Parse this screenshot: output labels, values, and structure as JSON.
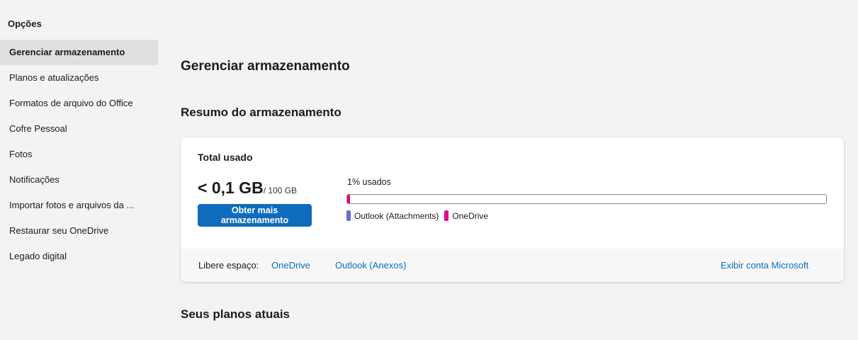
{
  "sidebar": {
    "header": "Opções",
    "items": [
      {
        "label": "Gerenciar armazenamento",
        "active": true
      },
      {
        "label": "Planos e atualizações"
      },
      {
        "label": "Formatos de arquivo do Office"
      },
      {
        "label": "Cofre Pessoal"
      },
      {
        "label": "Fotos"
      },
      {
        "label": "Notificações"
      },
      {
        "label": "Importar fotos e arquivos da ..."
      },
      {
        "label": "Restaurar seu OneDrive"
      },
      {
        "label": "Legado digital"
      }
    ]
  },
  "main": {
    "page_title": "Gerenciar armazenamento",
    "summary_title": "Resumo do armazenamento",
    "plans_title": "Seus planos atuais"
  },
  "storage": {
    "card_title": "Total usado",
    "used": "< 0,1 GB",
    "total": "/ 100 GB",
    "get_more_label": "Obter mais armazenamento",
    "usage_label": "1% usados",
    "usage_segments": [
      {
        "name": "Outlook (Attachments)",
        "fraction": 0.0,
        "color": "#6b69d6"
      },
      {
        "name": "OneDrive",
        "fraction": 0.005,
        "color": "#e3008c"
      }
    ],
    "legend": [
      {
        "label": "Outlook (Attachments)",
        "color": "#6b69d6"
      },
      {
        "label": "OneDrive",
        "color": "#e3008c"
      }
    ],
    "free_space_label": "Libere espaço:",
    "free_links": [
      "OneDrive",
      "Outlook (Anexos)"
    ],
    "account_link": "Exibir conta Microsoft"
  },
  "colors": {
    "accent": "#0f6cbd",
    "active_nav": "#e0e0e0"
  }
}
